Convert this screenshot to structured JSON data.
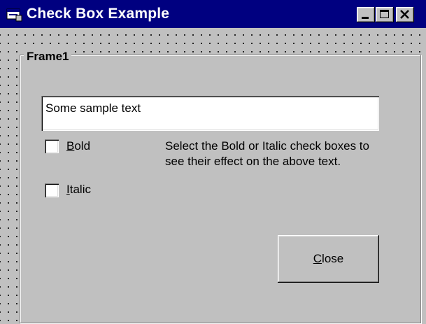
{
  "window": {
    "title": "Check Box Example",
    "icon": "form-icon"
  },
  "caption_buttons": [
    "minimize-icon",
    "maximize-icon",
    "close-icon"
  ],
  "frame": {
    "label": "Frame1"
  },
  "text_box": {
    "value": "Some sample text"
  },
  "checkboxes": [
    {
      "hotkey": "B",
      "rest": "old",
      "checked": false
    },
    {
      "hotkey": "I",
      "rest": "talic",
      "checked": false
    }
  ],
  "description": "Select the Bold or Italic check boxes to see their effect on the above text.",
  "close_button": {
    "hotkey": "C",
    "rest": "lose"
  },
  "colors": {
    "titlebar": "#000080",
    "face": "#c0c0c0"
  }
}
